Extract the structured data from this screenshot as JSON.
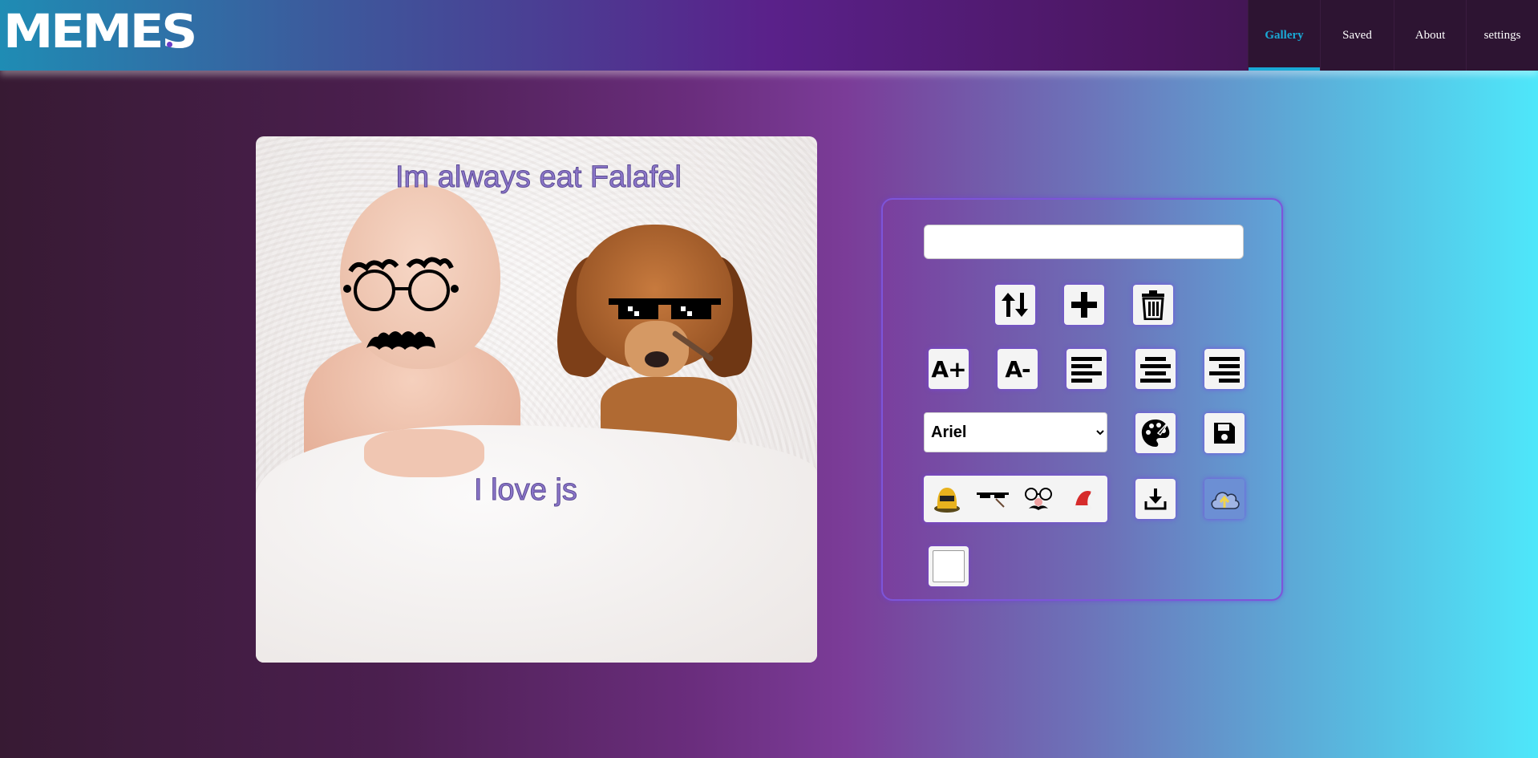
{
  "header": {
    "logo": "MEMES",
    "nav": [
      {
        "label": "Gallery",
        "active": true
      },
      {
        "label": "Saved",
        "active": false
      },
      {
        "label": "About",
        "active": false
      },
      {
        "label": "settings",
        "active": false
      }
    ]
  },
  "canvas": {
    "top_text": "Im always eat Falafel",
    "bottom_text": "I love js"
  },
  "editor": {
    "text_input_value": "",
    "font_select": {
      "selected": "Ariel"
    },
    "buttons": {
      "font_increase": "A+",
      "font_decrease": "A-"
    },
    "icons": {
      "switch": "swap-vertical-icon",
      "add": "plus-icon",
      "delete": "trash-icon",
      "align_left": "align-left-icon",
      "align_center": "align-center-icon",
      "align_right": "align-right-icon",
      "color": "palette-icon",
      "save": "floppy-disk-icon",
      "download": "download-icon",
      "upload": "cloud-upload-icon"
    },
    "stickers": [
      "taxi-hat",
      "pixel-sunglasses-cigarette",
      "groucho-glasses",
      "santa-hat"
    ]
  },
  "colors": {
    "accent": "#1aa9d6",
    "panel_border": "#7d55d9",
    "meme_text": "#8b76c9"
  }
}
